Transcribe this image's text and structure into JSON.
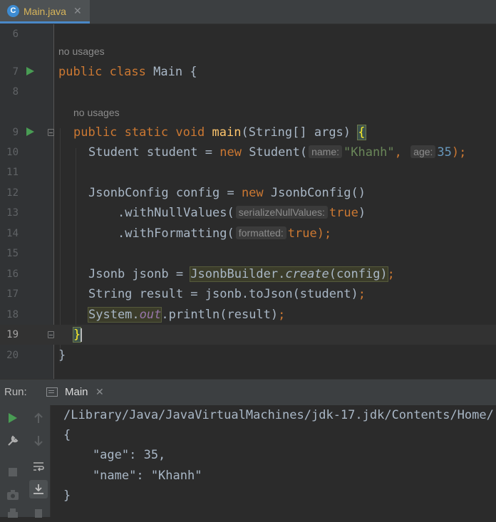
{
  "tab": {
    "icon": "C",
    "label": "Main.java",
    "close": "✕"
  },
  "editor": {
    "usages": "no usages",
    "lines": [
      {
        "n": "6"
      },
      {
        "n": "7"
      },
      {
        "n": "8"
      },
      {
        "n": "9"
      },
      {
        "n": "10"
      },
      {
        "n": "11"
      },
      {
        "n": "12"
      },
      {
        "n": "13"
      },
      {
        "n": "14"
      },
      {
        "n": "15"
      },
      {
        "n": "16"
      },
      {
        "n": "17"
      },
      {
        "n": "18"
      },
      {
        "n": "19"
      },
      {
        "n": "20"
      }
    ],
    "code": {
      "l7": {
        "kw1": "public",
        "kw2": "class",
        "name": "Main",
        "brace": "{"
      },
      "l9": {
        "kw1": "public",
        "kw2": "static",
        "kw3": "void",
        "fn": "main",
        "rest": "(String[] args) ",
        "brace": "{"
      },
      "l10": {
        "a": "Student student = ",
        "kw": "new",
        "b": " Student(",
        "h1": "name:",
        "s": "\"Khanh\"",
        "c": ",",
        "h2": "age:",
        "n": "35",
        "d": ");"
      },
      "l12": {
        "a": "JsonbConfig config = ",
        "kw": "new",
        "b": " JsonbConfig()"
      },
      "l13": {
        "a": ".withNullValues(",
        "h": "serializeNullValues:",
        "kw": "true",
        "b": ")"
      },
      "l14": {
        "a": ".withFormatting(",
        "h": "formatted:",
        "kw": "true",
        "b": ");"
      },
      "l16": {
        "a": "Jsonb jsonb = ",
        "cls": "JsonbBuilder.",
        "m": "create",
        "arg": "(config)",
        "semi": ";"
      },
      "l17": {
        "a": "String result = jsonb.toJson(student)",
        "semi": ";"
      },
      "l18": {
        "cls": "System.",
        "st": "out",
        "b": ".println(result)",
        "semi": ";"
      },
      "l19": {
        "brace": "}"
      },
      "l20": {
        "brace": "}"
      }
    }
  },
  "run": {
    "label": "Run:",
    "tab_label": "Main",
    "close": "✕",
    "console": [
      "/Library/Java/JavaVirtualMachines/jdk-17.jdk/Contents/Home/",
      "{",
      "    \"age\": 35,",
      "    \"name\": \"Khanh\"",
      "}"
    ]
  },
  "colors": {
    "keyword": "#cc7832",
    "method": "#ffc66d",
    "string": "#6a8759",
    "number": "#6897bb",
    "text": "#a9b7c6"
  }
}
